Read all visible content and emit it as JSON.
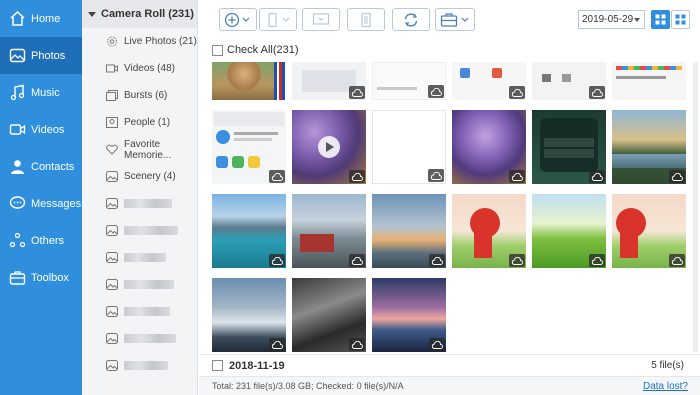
{
  "nav": [
    {
      "label": "Home",
      "icon": "home-icon",
      "active": false
    },
    {
      "label": "Photos",
      "icon": "photos-icon",
      "active": true
    },
    {
      "label": "Music",
      "icon": "music-icon",
      "active": false
    },
    {
      "label": "Videos",
      "icon": "videos-icon",
      "active": false
    },
    {
      "label": "Contacts",
      "icon": "contacts-icon",
      "active": false
    },
    {
      "label": "Messages",
      "icon": "messages-icon",
      "active": false
    },
    {
      "label": "Others",
      "icon": "others-icon",
      "active": false
    },
    {
      "label": "Toolbox",
      "icon": "toolbox-icon",
      "active": false
    }
  ],
  "albums": {
    "header": "Camera Roll (231)",
    "items": [
      {
        "label": "Live Photos (21)",
        "icon": "live-photos-icon"
      },
      {
        "label": "Videos (48)",
        "icon": "video-icon"
      },
      {
        "label": "Bursts (6)",
        "icon": "bursts-icon"
      },
      {
        "label": "People (1)",
        "icon": "people-icon"
      },
      {
        "label": "Favorite Memorie...",
        "icon": "heart-icon"
      },
      {
        "label": "Scenery (4)",
        "icon": "scenery-icon"
      }
    ],
    "blurred_count": 7
  },
  "toolbar": {
    "date_value": "2019-05-29"
  },
  "check_all_label": "Check All(231)",
  "date_group": {
    "date": "2018-11-19",
    "count": "5 file(s)"
  },
  "status": {
    "text": "Total: 231 file(s)/3.08 GB; Checked: 0 file(s)/N/A",
    "link": "Data lost?"
  },
  "colors": {
    "nav_bg": "#2f8fdd",
    "nav_active": "#1f6fb8",
    "accent": "#4a7fb8",
    "link": "#1a73c9"
  }
}
